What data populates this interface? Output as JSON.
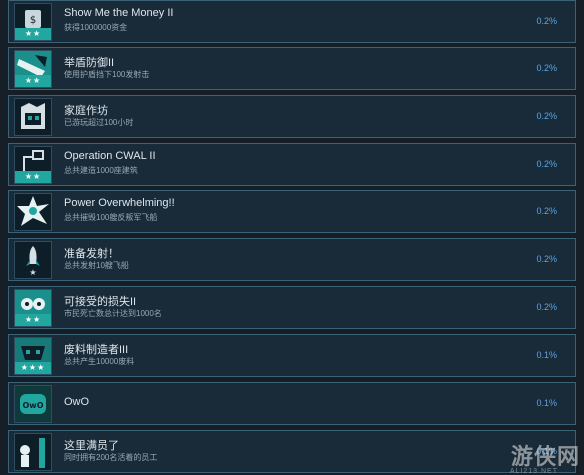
{
  "achievements": [
    {
      "name": "Show Me the Money II",
      "desc": "获得1000000资金",
      "pct": "0.2%",
      "stars": "★★",
      "icon": "money-icon"
    },
    {
      "name": "举盾防御II",
      "desc": "使用护盾挡下100发射击",
      "pct": "0.2%",
      "stars": "★★",
      "icon": "shield-icon"
    },
    {
      "name": "家庭作坊",
      "desc": "已游玩超过100小时",
      "pct": "0.2%",
      "stars": "",
      "icon": "workshop-icon"
    },
    {
      "name": "Operation CWAL II",
      "desc": "总共建造1000座建筑",
      "pct": "0.2%",
      "stars": "★★",
      "icon": "construction-icon"
    },
    {
      "name": "Power Overwhelming!!",
      "desc": "总共摧毁100艘反叛军飞船",
      "pct": "0.2%",
      "stars": "",
      "icon": "explosion-icon"
    },
    {
      "name": "准备发射！",
      "desc": "总共发射10艘飞船",
      "pct": "0.2%",
      "stars": "★",
      "icon": "rocket-icon"
    },
    {
      "name": "可接受的损失II",
      "desc": "市民死亡数总计达到1000名",
      "pct": "0.2%",
      "stars": "★★",
      "icon": "skull-icon"
    },
    {
      "name": "废料制造者III",
      "desc": "总共产生10000废料",
      "pct": "0.1%",
      "stars": "★★★",
      "icon": "scrap-icon"
    },
    {
      "name": "OwO",
      "desc": "",
      "pct": "0.1%",
      "stars": "",
      "icon": "owo-icon"
    },
    {
      "name": "这里满员了",
      "desc": "同时拥有200名活着的员工",
      "pct": "0.1%",
      "stars": "",
      "icon": "crowd-icon"
    }
  ],
  "watermark": {
    "text": "游侠网",
    "sub": "ALI213.NET"
  },
  "colors": {
    "accent": "#22a7a0",
    "percent": "#5aa6e6",
    "row_bg": "#192a38",
    "row_border": "#3c6277"
  }
}
